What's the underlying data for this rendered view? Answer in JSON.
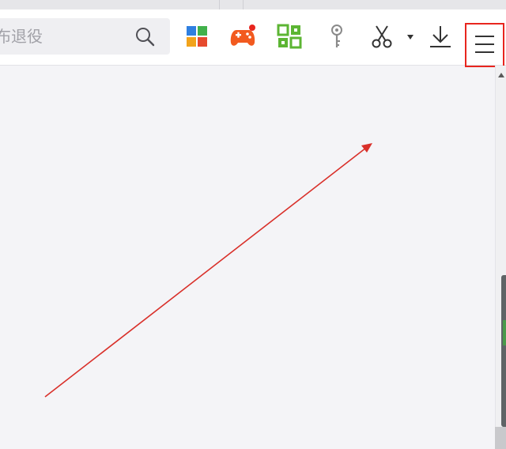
{
  "search": {
    "text": "布退役",
    "search_icon": "magnifier-icon"
  },
  "toolbar": {
    "icons": [
      "windows-apps-icon",
      "game-controller-icon",
      "qr-apps-icon",
      "key-icon",
      "scissors-icon",
      "dropdown-arrow-icon",
      "download-icon",
      "hamburger-menu-icon"
    ]
  },
  "colors": {
    "highlight": "#e8251e",
    "annotation_arrow": "#d9302a",
    "game_icon": "#f25a1f",
    "qr_icon": "#5cb533",
    "windows_tiles": [
      "#2f7fe0",
      "#41b14b",
      "#f2a31b",
      "#e64a2e"
    ]
  }
}
